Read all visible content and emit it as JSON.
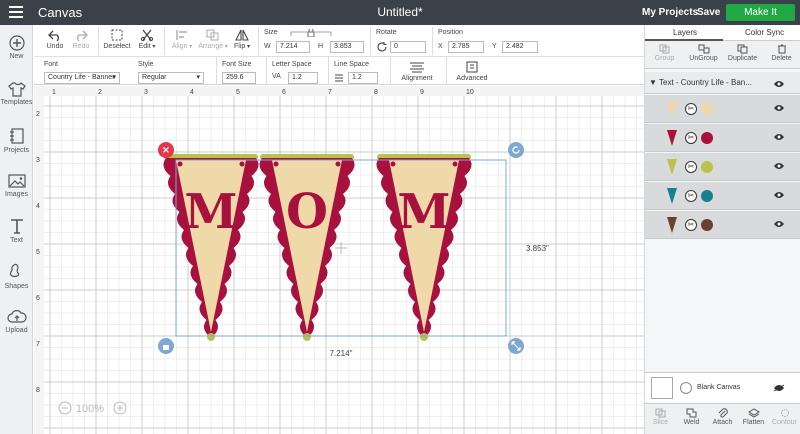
{
  "topbar": {
    "app_title": "Canvas",
    "doc_title": "Untitled*",
    "my_projects": "My Projects",
    "save": "Save",
    "make_it": "Make It"
  },
  "leftbar": {
    "items": [
      {
        "label": "New",
        "icon": "plus-icon"
      },
      {
        "label": "Templates",
        "icon": "shirt-icon"
      },
      {
        "label": "Projects",
        "icon": "projects-icon"
      },
      {
        "label": "Images",
        "icon": "image-icon"
      },
      {
        "label": "Text",
        "icon": "text-icon"
      },
      {
        "label": "Shapes",
        "icon": "shapes-icon"
      },
      {
        "label": "Upload",
        "icon": "upload-icon"
      }
    ]
  },
  "toolbar": {
    "undo": "Undo",
    "redo": "Redo",
    "deselect": "Deselect",
    "edit": "Edit",
    "align": "Align",
    "arrange": "Arrange",
    "flip": "Flip",
    "size_label": "Size",
    "w_label": "W",
    "w_value": "7.214",
    "h_label": "H",
    "h_value": "3.853",
    "rotate_label": "Rotate",
    "rotate_value": "0",
    "position_label": "Position",
    "x_label": "X",
    "x_value": "2.785",
    "y_label": "Y",
    "y_value": "2.482",
    "font_label": "Font",
    "font_value": "Country Life - Banner",
    "style_label": "Style",
    "style_value": "Regular",
    "font_size_label": "Font Size",
    "font_size_value": "259.6",
    "letter_space_label": "Letter Space",
    "letter_space_value": "1.2",
    "line_space_label": "Line Space",
    "line_space_value": "1.2",
    "alignment": "Alignment",
    "advanced": "Advanced"
  },
  "canvas": {
    "ruler_top": [
      "1",
      "2",
      "3",
      "4",
      "5",
      "6",
      "7",
      "8",
      "9",
      "10"
    ],
    "ruler_left": [
      "2",
      "3",
      "4",
      "5",
      "6",
      "7",
      "8"
    ],
    "width_label": "7.214\"",
    "height_label": "3.853\"",
    "zoom": "100%",
    "letters": [
      "M",
      "O",
      "M"
    ],
    "colors": {
      "banner_fill": "#f0d9a8",
      "banner_trim": "#a8103e",
      "top_bar": "#b9c24a",
      "selection": "#7fa8d0",
      "delete_handle": "#e03a4a",
      "grid_line": "#dde1e4",
      "grid_major": "#c9ced2"
    }
  },
  "rightpanel": {
    "tabs": [
      "Layers",
      "Color Sync"
    ],
    "actions": [
      {
        "label": "Group",
        "dim": true
      },
      {
        "label": "UnGroup",
        "dim": false
      },
      {
        "label": "Duplicate",
        "dim": false
      },
      {
        "label": "Delete",
        "dim": false
      }
    ],
    "group_title": "Text - Country Life - Ban...",
    "layers": [
      {
        "color": "#f0d9a8"
      },
      {
        "color": "#a8103e"
      },
      {
        "color": "#b9c24a"
      },
      {
        "color": "#16828f"
      },
      {
        "color": "#6b4030"
      }
    ],
    "blank_canvas": "Blank Canvas",
    "bottom_actions": [
      "Slice",
      "Weld",
      "Attach",
      "Flatten",
      "Contour"
    ]
  }
}
